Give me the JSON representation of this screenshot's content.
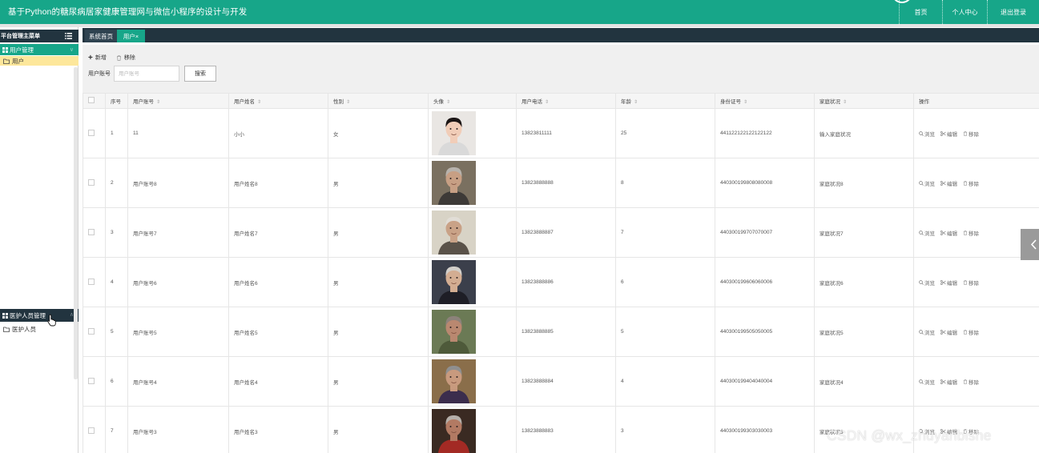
{
  "header": {
    "title": "基于Python的糖尿病居家健康管理网与微信小程序的设计与开发",
    "nav_home": "首页",
    "nav_user": "个人中心",
    "nav_logout": "退出登录"
  },
  "sidebar": {
    "title": "平台管理主菜单",
    "groups": [
      {
        "label": "用户管理",
        "items": [
          "用户"
        ]
      },
      {
        "label": "医护人员管理",
        "items": [
          "医护人员"
        ]
      }
    ]
  },
  "tabs": [
    {
      "label": "系统首页"
    },
    {
      "label": "用户×"
    }
  ],
  "toolbar": {
    "add_label": "新增",
    "delete_label": "移除"
  },
  "search": {
    "label": "用户账号",
    "placeholder": "用户账号",
    "button": "搜索"
  },
  "table": {
    "headers": [
      "序号",
      "用户账号",
      "用户姓名",
      "性别",
      "头像",
      "用户电话",
      "年龄",
      "身份证号",
      "家庭状况",
      "操作"
    ],
    "ops": {
      "view": "浏览",
      "edit": "编辑",
      "delete": "移除"
    },
    "rows": [
      {
        "no": "1",
        "account": "11",
        "name": "小小",
        "gender": "女",
        "phone": "13823811111",
        "age": "25",
        "id_card": "441122122122122122",
        "family": "输入家庭状况"
      },
      {
        "no": "2",
        "account": "用户账号8",
        "name": "用户姓名8",
        "gender": "男",
        "phone": "13823888888",
        "age": "8",
        "id_card": "440300199808080008",
        "family": "家庭状况8"
      },
      {
        "no": "3",
        "account": "用户账号7",
        "name": "用户姓名7",
        "gender": "男",
        "phone": "13823888887",
        "age": "7",
        "id_card": "440300199707070007",
        "family": "家庭状况7"
      },
      {
        "no": "4",
        "account": "用户账号6",
        "name": "用户姓名6",
        "gender": "男",
        "phone": "13823888886",
        "age": "6",
        "id_card": "440300199606060006",
        "family": "家庭状况6"
      },
      {
        "no": "5",
        "account": "用户账号5",
        "name": "用户姓名5",
        "gender": "男",
        "phone": "13823888885",
        "age": "5",
        "id_card": "440300199505050005",
        "family": "家庭状况5"
      },
      {
        "no": "6",
        "account": "用户账号4",
        "name": "用户姓名4",
        "gender": "男",
        "phone": "13823888884",
        "age": "4",
        "id_card": "440300199404040004",
        "family": "家庭状况4"
      },
      {
        "no": "7",
        "account": "用户账号3",
        "name": "用户姓名3",
        "gender": "男",
        "phone": "13823888883",
        "age": "3",
        "id_card": "440300199303030003",
        "family": "家庭状况3"
      }
    ]
  },
  "watermark": "CSDN @wx_zhuyanbishe",
  "colors": {
    "brand": "#17a689",
    "dark": "#22343f",
    "highlight": "#fde79b"
  }
}
